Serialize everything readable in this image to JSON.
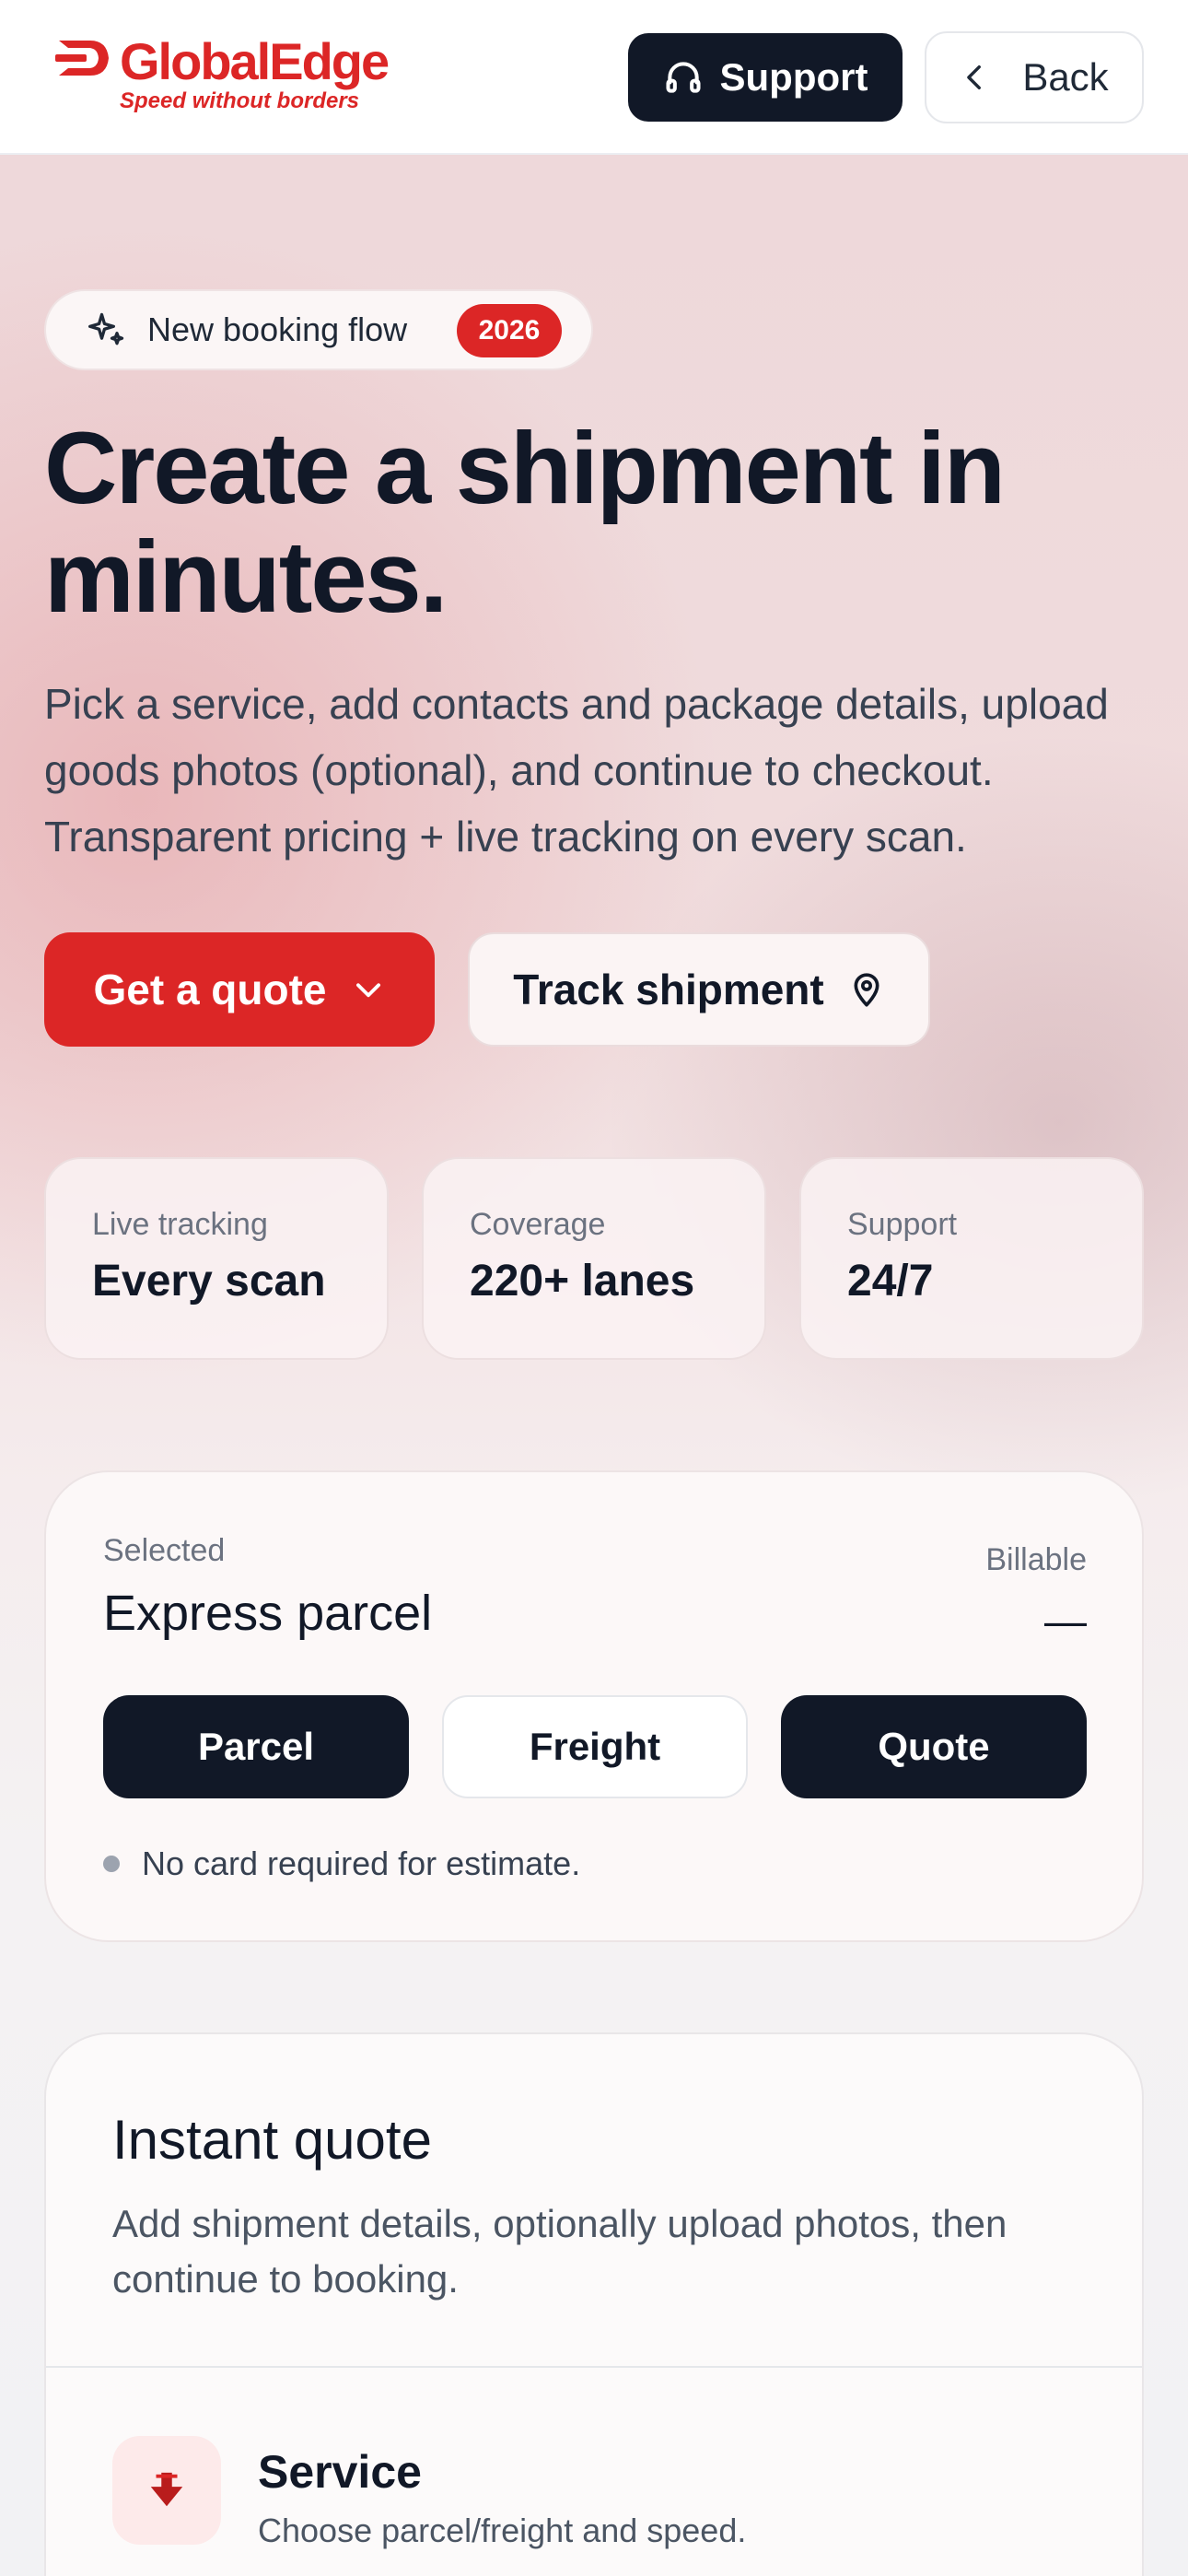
{
  "header": {
    "brand_name": "GlobalEdge",
    "brand_tagline": "Speed without borders",
    "support_label": "Support",
    "back_label": "Back"
  },
  "hero": {
    "pill_label": "New booking flow",
    "pill_badge": "2026",
    "headline_line1": "Create a shipment in",
    "headline_line2": "minutes.",
    "lede_line1": "Pick a service, add contacts and package details, upload",
    "lede_line2": "goods photos (optional), and continue to checkout.",
    "lede_line3": "Transparent pricing + live tracking on every scan.",
    "quote_button": "Get a quote",
    "track_button": "Track shipment"
  },
  "stats": [
    {
      "label": "Live tracking",
      "value": "Every scan"
    },
    {
      "label": "Coverage",
      "value": "220+ lanes"
    },
    {
      "label": "Support",
      "value": "24/7"
    }
  ],
  "selection": {
    "selected_label": "Selected",
    "selected_value": "Express parcel",
    "billable_label": "Billable",
    "billable_value": "—",
    "segments": [
      "Parcel",
      "Freight",
      "Quote"
    ],
    "note": "No card required for estimate."
  },
  "quote_card": {
    "title": "Instant quote",
    "desc_line1": "Add shipment details, optionally upload photos, then",
    "desc_line2": "continue to booking.",
    "service_title": "Service",
    "service_desc": "Choose parcel/freight and speed."
  },
  "colors": {
    "brand_red": "#dc2626",
    "dark": "#111827"
  },
  "icons": {
    "support": "headset-icon",
    "back": "chevron-left-icon",
    "pill": "sparkles-icon",
    "quote": "chevron-down-icon",
    "track": "map-pin-icon",
    "service": "arrow-down-icon"
  }
}
